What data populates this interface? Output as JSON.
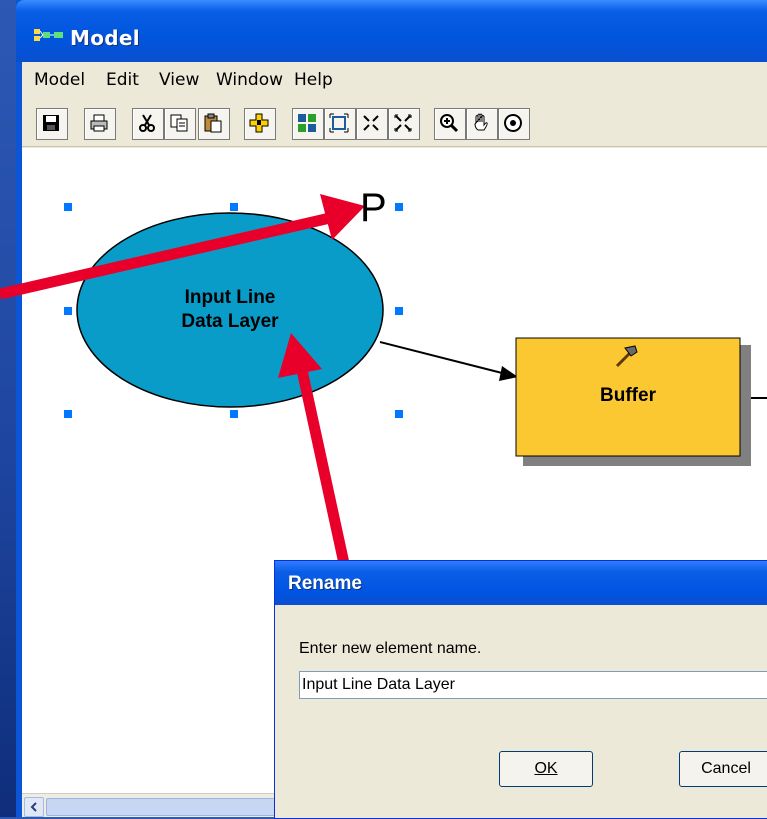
{
  "window": {
    "title": "Model"
  },
  "menu": {
    "items": [
      "Model",
      "Edit",
      "View",
      "Window",
      "Help"
    ]
  },
  "toolbar": {
    "buttons": [
      {
        "icon": "save-icon"
      },
      {
        "icon": "print-icon"
      },
      {
        "icon": "cut-icon"
      },
      {
        "icon": "copy-icon"
      },
      {
        "icon": "paste-icon"
      },
      {
        "icon": "add-data-icon"
      },
      {
        "icon": "select-all-icon"
      },
      {
        "icon": "full-extent-icon"
      },
      {
        "icon": "zoom-in-fixed-icon"
      },
      {
        "icon": "zoom-out-fixed-icon"
      },
      {
        "icon": "zoom-in-icon"
      },
      {
        "icon": "pan-icon"
      },
      {
        "icon": "globe-icon"
      }
    ]
  },
  "diagram": {
    "input_node": {
      "line1": "Input Line",
      "line2": "Data Layer"
    },
    "tool_node": {
      "label": "Buffer"
    },
    "parameter_marker": "P",
    "colors": {
      "input": "#0a9cc8",
      "tool": "#fcc832",
      "arrow": "#e8002a"
    }
  },
  "dialog": {
    "title": "Rename",
    "prompt": "Enter new element name.",
    "input_value": "Input Line Data Layer",
    "ok_label": "OK",
    "cancel_label": "Cancel"
  }
}
